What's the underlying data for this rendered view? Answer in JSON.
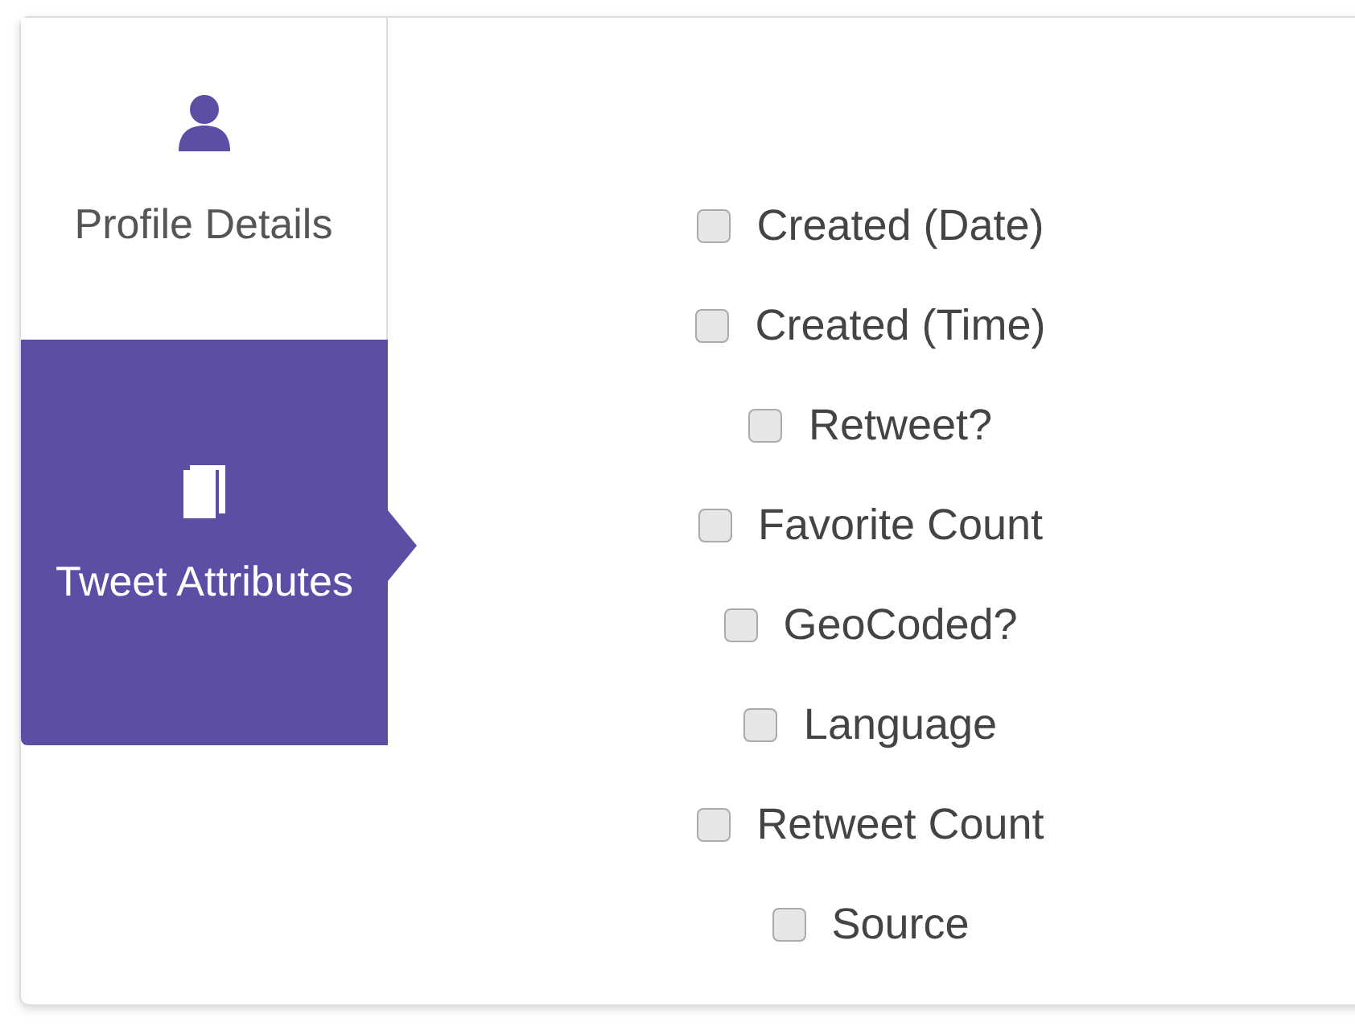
{
  "tabs": [
    {
      "label": "Profile Details",
      "kind": "user",
      "selected": false
    },
    {
      "label": "Tweet Attributes",
      "kind": "book",
      "selected": true
    }
  ],
  "options": [
    {
      "label": "Created (Date)",
      "checked": false
    },
    {
      "label": "Created (Time)",
      "checked": false
    },
    {
      "label": "Retweet?",
      "checked": false
    },
    {
      "label": "Favorite Count",
      "checked": false
    },
    {
      "label": "GeoCoded?",
      "checked": false
    },
    {
      "label": "Language",
      "checked": false
    },
    {
      "label": "Retweet Count",
      "checked": false
    },
    {
      "label": "Source",
      "checked": false
    }
  ]
}
